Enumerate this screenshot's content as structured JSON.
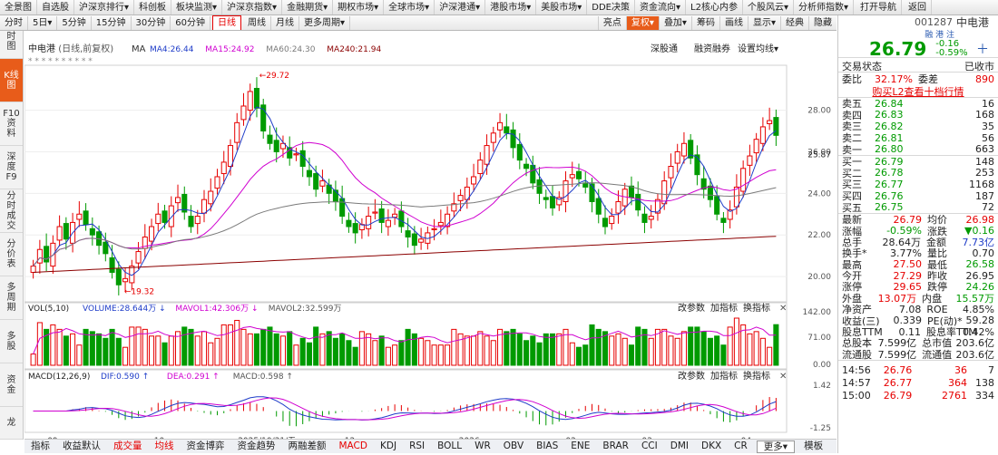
{
  "topbar": {
    "items": [
      "全景图",
      "自选股",
      "沪深京排行▾",
      "科创板",
      "板块监测▾",
      "沪深京指数▾",
      "金融期货▾",
      "期权市场▾",
      "全球市场▾",
      "沪深港通▾",
      "港股市场▾",
      "美股市场▾",
      "DDE决策",
      "资金流向▾",
      "L2核心内参",
      "个股风云▾",
      "分析师指数▾",
      "打开导航",
      "返回"
    ],
    "periods": [
      "分时",
      "5日▾",
      "5分钟",
      "15分钟",
      "30分钟",
      "60分钟",
      "日线",
      "周线",
      "月线",
      "更多周期▾"
    ],
    "active_period": "日线",
    "tools": [
      "亮点",
      "复权▾",
      "叠加▾",
      "筹码",
      "画线",
      "显示▾",
      "经典",
      "隐藏"
    ],
    "active_tool": "复权▾"
  },
  "lefttabs": [
    "分时图",
    "K线图",
    "F10资料",
    "深度F9",
    "分时成交",
    "分价表",
    "多周期",
    "多股",
    "资金",
    "龙"
  ],
  "left_active": "K线图",
  "chart": {
    "name": "中电港",
    "mode": "(日线,前复权)",
    "ma": [
      {
        "label": "MA4:26.44",
        "color": "#1e3cc8"
      },
      {
        "label": "MA15:24.92",
        "color": "#d000d0"
      },
      {
        "label": "MA60:24.30",
        "color": "#7a7a7a"
      },
      {
        "label": "MA240:21.94",
        "color": "#8b0000"
      }
    ],
    "links": [
      "深股通",
      "融资融券",
      "设置均线▾"
    ],
    "price_ticks": [
      "28.00",
      "26.00",
      "24.00",
      "22.00",
      "20.00"
    ],
    "last_price": "25.87",
    "high_note": "29.72",
    "low_note": "19.32",
    "vol_title": "VOL(5,10)",
    "vol_items": [
      {
        "label": "VOLUME:28.644万 ↓",
        "color": "#1e3cc8"
      },
      {
        "label": "MAVOL1:42.306万 ↓",
        "color": "#d000d0"
      },
      {
        "label": "MAVOL2:32.599万",
        "color": "#555"
      }
    ],
    "vol_ticks": [
      "142.00",
      "71.00",
      "0.00"
    ],
    "macd_title": "MACD(12,26,9)",
    "macd_items": [
      {
        "label": "DIF:0.590 ↑",
        "color": "#1e3cc8"
      },
      {
        "label": "DEA:0.291 ↑",
        "color": "#d000d0"
      },
      {
        "label": "MACD:0.598 ↑",
        "color": "#555"
      }
    ],
    "macd_ticks": [
      "1.42",
      "-1.25"
    ],
    "panel_buttons": [
      "改参数",
      "加指标",
      "换指标"
    ],
    "dates": [
      "09",
      "10",
      "2025/10/31/五",
      "12",
      "2026",
      "02",
      "03",
      "04"
    ]
  },
  "chart_data": {
    "type": "candlestick",
    "title": "中电港",
    "subtitle": "(日线,前复权)",
    "y_range": [
      19.0,
      29.9
    ],
    "high": 29.72,
    "low": 19.32,
    "last": 25.87,
    "x_labels": [
      "09",
      "10",
      "2025/10/31/五",
      "12",
      "2026",
      "02",
      "03",
      "04"
    ],
    "close_path": [
      20.5,
      21.3,
      20.7,
      21.6,
      22.4,
      21.8,
      22.6,
      23.0,
      22.5,
      22.0,
      21.5,
      21.1,
      20.2,
      19.6,
      19.9,
      20.5,
      21.2,
      21.9,
      22.4,
      23.0,
      22.6,
      23.4,
      23.8,
      23.1,
      22.4,
      22.9,
      23.7,
      24.1,
      24.8,
      25.5,
      26.3,
      27.4,
      28.2,
      28.9,
      28.1,
      27.0,
      26.4,
      26.0,
      26.4,
      25.7,
      25.9,
      25.3,
      24.8,
      24.2,
      24.6,
      24.0,
      23.6,
      22.9,
      22.4,
      22.1,
      22.5,
      22.9,
      23.1,
      22.6,
      22.7,
      23.0,
      22.4,
      21.9,
      21.5,
      21.8,
      22.1,
      22.3,
      22.6,
      23.0,
      23.5,
      23.9,
      24.3,
      24.8,
      25.6,
      26.3,
      26.9,
      27.4,
      26.9,
      26.2,
      25.6,
      25.2,
      24.5,
      24.0,
      23.7,
      23.3,
      23.8,
      24.6,
      24.9,
      24.7,
      24.3,
      23.6,
      23.0,
      22.4,
      22.9,
      23.6,
      24.2,
      23.8,
      23.2,
      22.6,
      22.9,
      23.7,
      24.6,
      25.3,
      26.0,
      26.4,
      25.7,
      24.9,
      24.2,
      23.7,
      23.0,
      22.6,
      23.2,
      24.3,
      25.2,
      25.8,
      26.6,
      27.2,
      27.5,
      26.79
    ]
  },
  "side": {
    "code": "001287",
    "name": "中电港",
    "tags": "融 港 注",
    "price": "26.79",
    "change": "-0.16",
    "pct": "-0.59%",
    "state_label": "交易状态",
    "state_value": "已收市",
    "wb_label": "委比",
    "wb_value": "32.17%",
    "wc_label": "委差",
    "wc_value": "890",
    "l2": "购买L2查看十档行情",
    "asks": [
      {
        "l": "卖五",
        "p": "26.84",
        "v": "16"
      },
      {
        "l": "卖四",
        "p": "26.83",
        "v": "168"
      },
      {
        "l": "卖三",
        "p": "26.82",
        "v": "35"
      },
      {
        "l": "卖二",
        "p": "26.81",
        "v": "56"
      },
      {
        "l": "卖一",
        "p": "26.80",
        "v": "663"
      }
    ],
    "bids": [
      {
        "l": "买一",
        "p": "26.79",
        "v": "148"
      },
      {
        "l": "买二",
        "p": "26.78",
        "v": "253"
      },
      {
        "l": "买三",
        "p": "26.77",
        "v": "1168"
      },
      {
        "l": "买四",
        "p": "26.76",
        "v": "187"
      },
      {
        "l": "买五",
        "p": "26.75",
        "v": "72"
      }
    ],
    "stats": [
      [
        "最新",
        "26.79",
        "up",
        "均价",
        "26.98",
        "up"
      ],
      [
        "涨幅",
        "-0.59%",
        "dn",
        "涨跌",
        "▼0.16",
        "dn"
      ],
      [
        "总手",
        "28.64万",
        "",
        "金额",
        "7.73亿",
        "bl"
      ],
      [
        "换手*",
        "3.77%",
        "",
        "量比",
        "0.70",
        ""
      ],
      [
        "最高",
        "27.50",
        "up",
        "最低",
        "26.58",
        "dn"
      ],
      [
        "今开",
        "27.29",
        "up",
        "昨收",
        "26.95",
        ""
      ],
      [
        "涨停",
        "29.65",
        "up",
        "跌停",
        "24.26",
        "dn"
      ],
      [
        "外盘",
        "13.07万",
        "up",
        "内盘",
        "15.57万",
        "dn"
      ],
      [
        "净资产",
        "7.08",
        "",
        "ROE",
        "4.85%",
        ""
      ],
      [
        "收益(三)",
        "0.339",
        "",
        "PE(动)*",
        "59.28",
        ""
      ],
      [
        "股息TTM",
        "0.11",
        "",
        "股息率TTM",
        "0.42%",
        ""
      ],
      [
        "总股本",
        "7.599亿",
        "",
        "总市值",
        "203.6亿",
        ""
      ],
      [
        "流通股",
        "7.599亿",
        "",
        "流通值",
        "203.6亿",
        ""
      ]
    ],
    "ticks": [
      [
        "14:56",
        "26.76",
        "36",
        "7"
      ],
      [
        "14:57",
        "26.77",
        "364",
        "138"
      ],
      [
        "15:00",
        "26.79",
        "2761",
        "334"
      ]
    ]
  },
  "bottombar": [
    "指标",
    "收益默认",
    "成交量",
    "均线",
    "资金博弈",
    "资金趋势",
    "两融差额",
    "MACD",
    "KDJ",
    "RSI",
    "BOLL",
    "WR",
    "OBV",
    "BIAS",
    "ENE",
    "BRAR",
    "CCI",
    "DMI",
    "DKX",
    "CR",
    "更多▾",
    "模板"
  ],
  "bottom_highlight": [
    "成交量",
    "均线",
    "MACD"
  ]
}
